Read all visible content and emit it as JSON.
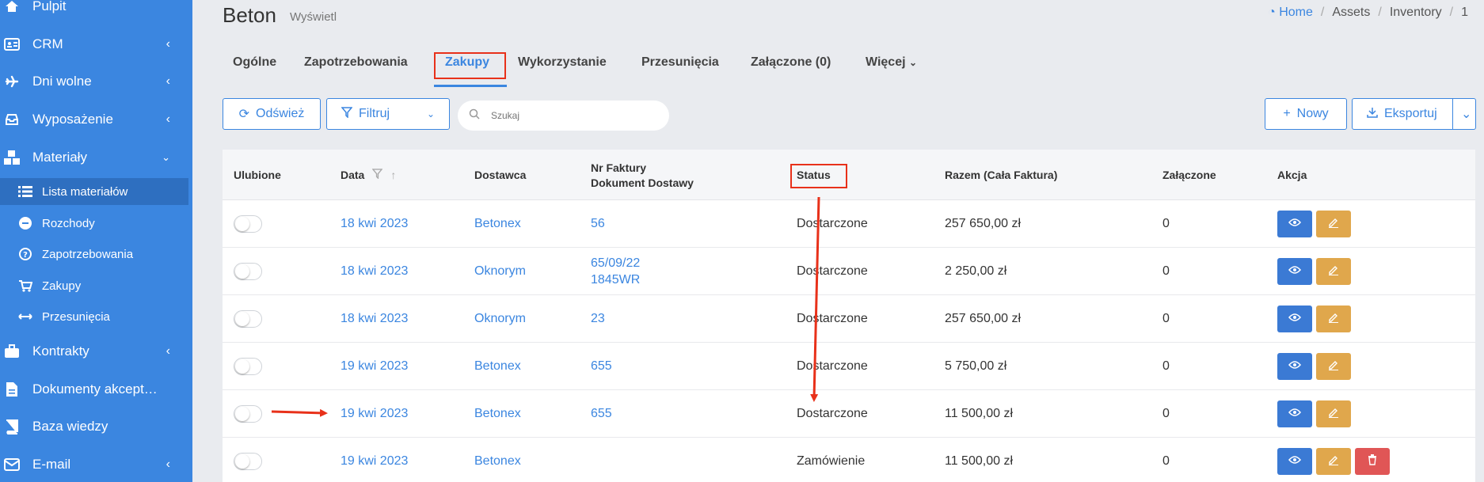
{
  "sidebar": {
    "items": [
      {
        "label": "Pulpit"
      },
      {
        "label": "CRM"
      },
      {
        "label": "Dni wolne"
      },
      {
        "label": "Wyposażenie"
      },
      {
        "label": "Materiały"
      },
      {
        "label": "Kontrakty"
      },
      {
        "label": "Dokumenty akcept…"
      },
      {
        "label": "Baza wiedzy"
      },
      {
        "label": "E-mail"
      }
    ],
    "subitems": [
      {
        "label": "Lista materiałów"
      },
      {
        "label": "Rozchody"
      },
      {
        "label": "Zapotrzebowania"
      },
      {
        "label": "Zakupy"
      },
      {
        "label": "Przesunięcia"
      }
    ]
  },
  "header": {
    "title": "Beton",
    "subtitle": "Wyświetl",
    "breadcrumb": [
      "Home",
      "Assets",
      "Inventory",
      "1"
    ]
  },
  "tabs": [
    "Ogólne",
    "Zapotrzebowania",
    "Zakupy",
    "Wykorzystanie",
    "Przesunięcia",
    "Załączone (0)",
    "Więcej"
  ],
  "toolbar": {
    "refresh": "Odśwież",
    "filter": "Filtruj",
    "search_placeholder": "Szukaj",
    "new": "Nowy",
    "export": "Eksportuj"
  },
  "table": {
    "headers": {
      "fav": "Ulubione",
      "date": "Data",
      "supplier": "Dostawca",
      "invoice_1": "Nr Faktury",
      "invoice_2": "Dokument Dostawy",
      "status": "Status",
      "total": "Razem (Cała Faktura)",
      "attached": "Załączone",
      "action": "Akcja"
    },
    "rows": [
      {
        "date": "18 kwi 2023",
        "supplier": "Betonex",
        "invoice": "56",
        "delivery": "",
        "status": "Dostarczone",
        "total": "257 650,00 zł",
        "attached": "0"
      },
      {
        "date": "18 kwi 2023",
        "supplier": "Oknorym",
        "invoice": "65/09/22",
        "delivery": "1845WR",
        "status": "Dostarczone",
        "total": "2 250,00 zł",
        "attached": "0"
      },
      {
        "date": "18 kwi 2023",
        "supplier": "Oknorym",
        "invoice": "23",
        "delivery": "",
        "status": "Dostarczone",
        "total": "257 650,00 zł",
        "attached": "0"
      },
      {
        "date": "19 kwi 2023",
        "supplier": "Betonex",
        "invoice": "655",
        "delivery": "",
        "status": "Dostarczone",
        "total": "5 750,00 zł",
        "attached": "0"
      },
      {
        "date": "19 kwi 2023",
        "supplier": "Betonex",
        "invoice": "655",
        "delivery": "",
        "status": "Dostarczone",
        "total": "11 500,00 zł",
        "attached": "0"
      },
      {
        "date": "19 kwi 2023",
        "supplier": "Betonex",
        "invoice": "",
        "delivery": "",
        "status": "Zamówienie",
        "total": "11 500,00 zł",
        "attached": "0"
      }
    ]
  },
  "colors": {
    "accent": "#3b86e0",
    "highlight": "#e8311a",
    "view": "#3b7ad4",
    "edit": "#e0a74c",
    "delete": "#e05656"
  }
}
